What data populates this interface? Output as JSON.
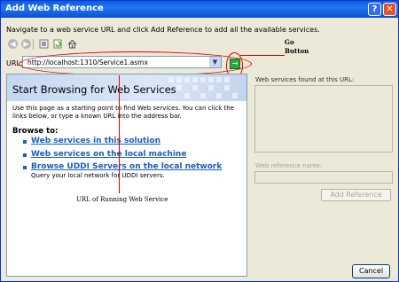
{
  "window": {
    "title": "Add Web Reference",
    "help_glyph": "?",
    "close_glyph": "✕"
  },
  "instructions": "Navigate to a web service URL and click Add Reference to add all the available services.",
  "toolbar": {
    "icons": [
      "back-icon",
      "forward-icon",
      "stop-icon",
      "refresh-icon",
      "home-icon"
    ],
    "back_glyph": "◀",
    "forward_glyph": "▶"
  },
  "url_bar": {
    "label": "URL:",
    "value": "http://localhost:1310/Service1.asmx",
    "dropdown_glyph": "▼",
    "go_glyph": "→"
  },
  "annotations": {
    "go_button": [
      "Go",
      "Button"
    ],
    "url": "URL of Running Web Service",
    "color": "#dd0000"
  },
  "browser": {
    "heading": "Start Browsing for Web Services",
    "intro": "Use this page as a starting point to find Web services. You can click the links below, or type a known URL into the address bar.",
    "browse_to": "Browse to:",
    "links": [
      "Web services in this solution",
      "Web services on the local machine",
      "Browse UDDI Servers on the local network"
    ],
    "uddi_desc": "Query your local network for UDDI servers."
  },
  "right_panel": {
    "found_label": "Web services found at this URL:",
    "ref_name_label": "Web reference name:",
    "add_reference": "Add Reference"
  },
  "footer": {
    "cancel": "Cancel"
  },
  "colors": {
    "title_bar": "#0a5fdb",
    "link": "#1d5dbb",
    "go_button": "#2aa536"
  }
}
